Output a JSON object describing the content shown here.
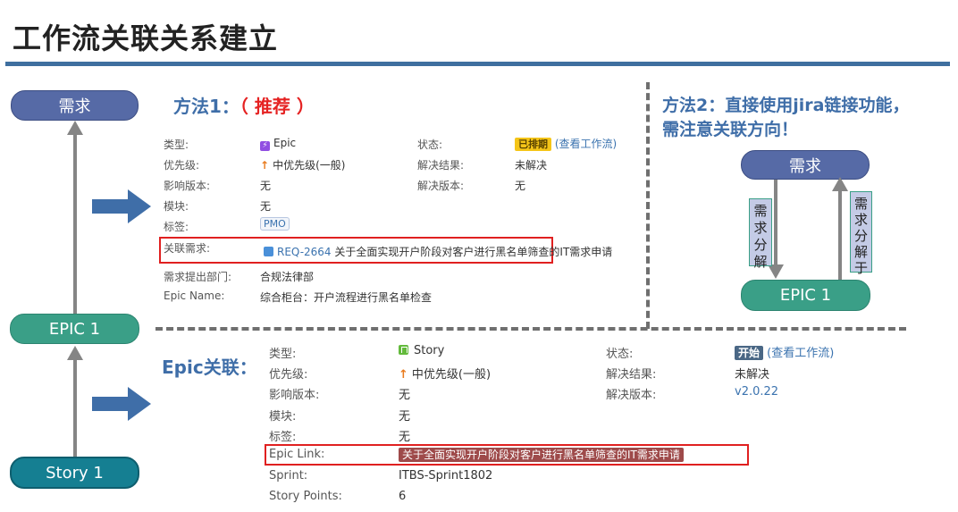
{
  "title": "工作流关联关系建立",
  "left_flow": {
    "top_node": "需求",
    "mid_node": "EPIC 1",
    "bottom_node": "Story 1"
  },
  "method1": {
    "heading": "方法1：",
    "recommend": "（ 推荐 ）",
    "fields_left": [
      {
        "label": "类型:",
        "value": "Epic"
      },
      {
        "label": "优先级:",
        "value": "中优先级(一般)"
      },
      {
        "label": "影响版本:",
        "value": "无"
      },
      {
        "label": "模块:",
        "value": "无"
      },
      {
        "label": "标签:",
        "value": "PMO"
      }
    ],
    "fields_right": [
      {
        "label": "状态:",
        "value": "已排期",
        "extra": "(查看工作流)"
      },
      {
        "label": "解决结果:",
        "value": "未解决"
      },
      {
        "label": "解决版本:",
        "value": "无"
      }
    ],
    "linked_req": {
      "label": "关联需求:",
      "key": "REQ-2664",
      "summary": "关于全面实现开户阶段对客户进行黑名单筛查的IT需求申请"
    },
    "dept": {
      "label": "需求提出部门:",
      "value": "合规法律部"
    },
    "epic_name": {
      "label": "Epic Name:",
      "value": "综合柜台：开户流程进行黑名单检查"
    }
  },
  "method2": {
    "heading_line1": "方法2：直接使用jira链接功能，",
    "heading_line2": "需注意关联方向！",
    "top_node": "需求",
    "bottom_node": "EPIC 1",
    "left_box": [
      "需",
      "求",
      "分",
      "解"
    ],
    "right_box": [
      "需",
      "求",
      "分",
      "解",
      "于"
    ]
  },
  "epic_link": {
    "heading": "Epic关联：",
    "fields_left": [
      {
        "label": "类型:",
        "value": "Story"
      },
      {
        "label": "优先级:",
        "value": "中优先级(一般)"
      },
      {
        "label": "影响版本:",
        "value": "无"
      },
      {
        "label": "模块:",
        "value": "无"
      },
      {
        "label": "标签:",
        "value": "无"
      }
    ],
    "fields_right": [
      {
        "label": "状态:",
        "value": "开始",
        "extra": "(查看工作流)"
      },
      {
        "label": "解决结果:",
        "value": "未解决"
      },
      {
        "label": "解决版本:",
        "value": "v2.0.22"
      }
    ],
    "epic_link_field": {
      "label": "Epic Link:",
      "value": "关于全面实现开户阶段对客户进行黑名单筛查的IT需求申请"
    },
    "sprint": {
      "label": "Sprint:",
      "value": "ITBS-Sprint1802"
    },
    "story_points": {
      "label": "Story Points:",
      "value": "6"
    }
  },
  "colors": {
    "accent_blue": "#3f6ea8",
    "red": "#e52222",
    "node_dark": "#566aa6",
    "node_green": "#3a9f87",
    "node_teal": "#157f92"
  }
}
